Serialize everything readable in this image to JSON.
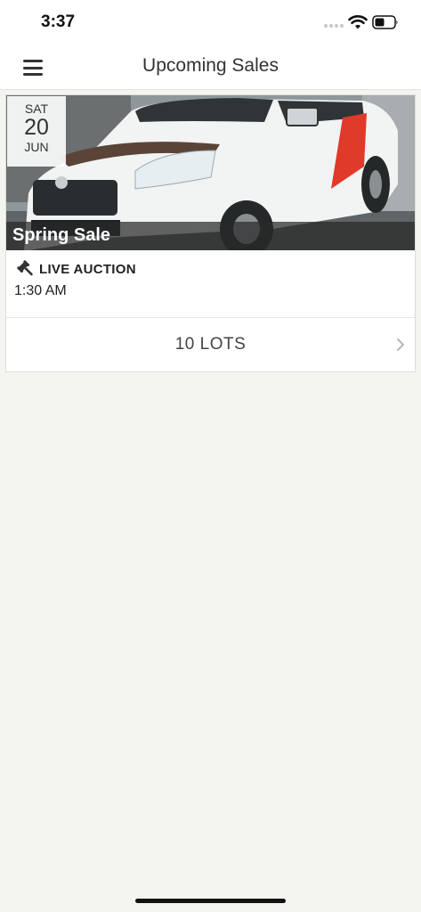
{
  "status_bar": {
    "time": "3:37",
    "icons": [
      "signal-icon",
      "wifi-icon",
      "battery-icon"
    ]
  },
  "nav": {
    "title": "Upcoming Sales",
    "menu_icon": "menu-icon"
  },
  "sales": [
    {
      "date": {
        "day_of_week": "SAT",
        "day": "20",
        "month": "JUN"
      },
      "title": "Spring Sale",
      "type_icon": "gavel-icon",
      "type_label": "LIVE AUCTION",
      "time": "1:30 AM",
      "lots_label": "10 LOTS",
      "lots_icon": "chevron-right-icon"
    }
  ],
  "colors": {
    "background": "#f4f4f0",
    "card": "#ffffff",
    "text": "#333333",
    "title_strip": "#282828"
  }
}
